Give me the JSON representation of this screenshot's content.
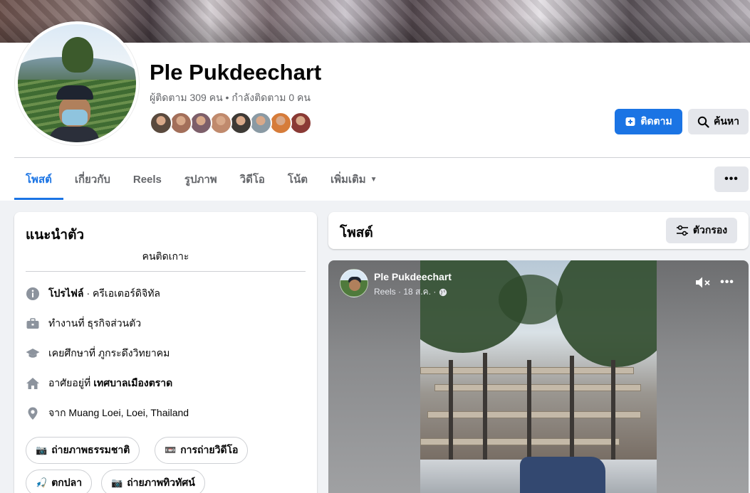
{
  "profile": {
    "name": "Ple Pukdeechart",
    "stats": "ผู้ติดตาม 309 คน • กำลังติดตาม 0 คน",
    "follower_avatars": [
      "#5a4a3e",
      "#a36f5a",
      "#7d5f6a",
      "#c08a6d",
      "#3e3a36",
      "#8a9aa4",
      "#d67c3a",
      "#8a3a35"
    ]
  },
  "actions": {
    "follow_label": "ติดตาม",
    "search_label": "ค้นหา",
    "more_label": "•••"
  },
  "tabs": [
    {
      "label": "โพสต์"
    },
    {
      "label": "เกี่ยวกับ"
    },
    {
      "label": "Reels"
    },
    {
      "label": "รูปภาพ"
    },
    {
      "label": "วิดีโอ"
    },
    {
      "label": "โน้ต"
    },
    {
      "label": "เพิ่มเติม"
    }
  ],
  "intro": {
    "title": "แนะนำตัว",
    "bio": "คนติดเกาะ",
    "rows": [
      {
        "icon": "info-icon",
        "bold": "โปรไฟล์",
        "text": " · ครีเอเตอร์ดิจิทัล",
        "prefix": ""
      },
      {
        "icon": "briefcase-icon",
        "prefix": "ทำงานที่ ธุรกิจส่วนตัว",
        "bold": "",
        "text": ""
      },
      {
        "icon": "graduation-cap-icon",
        "prefix": "เคยศึกษาที่ ภูกระดึงวิทยาคม",
        "bold": "",
        "text": ""
      },
      {
        "icon": "home-icon",
        "prefix": "อาศัยอยู่ที่",
        "bold": "เทศบาลเมืองตราด",
        "text": ""
      },
      {
        "icon": "location-pin-icon",
        "prefix": "จาก Muang Loei, Loei, Thailand",
        "bold": "",
        "text": ""
      }
    ],
    "hobbies": [
      {
        "icon": "📷",
        "label": "ถ่ายภาพธรรมชาติ"
      },
      {
        "icon": "📼",
        "label": "การถ่ายวิดีโอ"
      },
      {
        "icon": "🎣",
        "label": "ตกปลา"
      },
      {
        "icon": "📷",
        "label": "ถ่ายภาพทิวทัศน์"
      }
    ]
  },
  "posts": {
    "title": "โพสต์",
    "filter_label": "ตัวกรอง"
  },
  "reel": {
    "author": "Ple Pukdeechart",
    "meta": "Reels · 18 ส.ค. ·"
  },
  "colors": {
    "accent": "#1b74e4",
    "secondary_button": "#e4e6eb",
    "muted_text": "#65676b"
  }
}
